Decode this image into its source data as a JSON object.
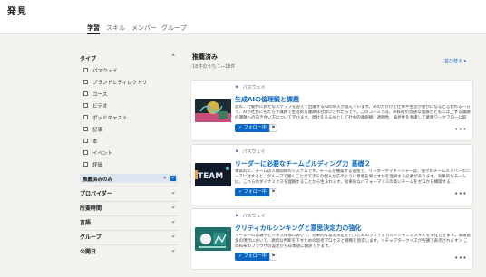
{
  "page": {
    "title": "発見"
  },
  "tabs": [
    {
      "label": "学習",
      "active": true
    },
    {
      "label": "スキル",
      "active": false
    },
    {
      "label": "メンバー",
      "active": false
    },
    {
      "label": "グループ",
      "active": false
    }
  ],
  "sidebar": {
    "type_section": {
      "label": "タイプ",
      "items": [
        {
          "label": "パスウェイ",
          "checked": false
        },
        {
          "label": "ブランドとディレクトリ",
          "checked": false
        },
        {
          "label": "コース",
          "checked": false
        },
        {
          "label": "ビデオ",
          "checked": false
        },
        {
          "label": "ポッドキャスト",
          "checked": false
        },
        {
          "label": "記事",
          "checked": false
        },
        {
          "label": "本",
          "checked": false
        },
        {
          "label": "イベント",
          "checked": false
        },
        {
          "label": "評価",
          "checked": false
        }
      ]
    },
    "recommended_filter": {
      "label": "推薦済みのみ",
      "remove": "✕",
      "checked": true
    },
    "sections": [
      {
        "label": "プロバイダー"
      },
      {
        "label": "所要時間"
      },
      {
        "label": "言語"
      },
      {
        "label": "グループ"
      },
      {
        "label": "公開日"
      }
    ]
  },
  "results": {
    "title": "推薦済み",
    "count": "18件のうち 1―18件",
    "sort_label": "並び替え ▾",
    "items": [
      {
        "type": "パスウェイ",
        "title": "生成AIの倫理観と課題",
        "description": "近年、行動界に新たなステップを迎えて出展するAIの導入が進んでいます。AIの力がけで仕事や生活が豊かになると言われる一方で、AIが社会にもたらす課題で生活的な課題は社会にされたらです。このコースでは、AI技術の急速な発展とともに浮上する課題の課題への向き合い方について学びます。愛社をあるAIとして社会的価値観、透明性、偏見性を考慮して業務ワークフローに取り...",
        "follow_label": "✓ フォロー中",
        "save_label": "⚑",
        "more_label": "•••"
      },
      {
        "type": "パスウェイ",
        "title": "リーダーに必要なチームビルディング力_基礎２",
        "description": "本質的に、チームは人間関係のシステムです。チームを構築する過程で、リーダーやマネージャーは、個々のチームメンバーのニーズに対すると、グループで働くことができるの個人が広のように意義を果たすかを理解する必要があります。効果的なチームは、これらのダイナミクスを理解することから生まれます。効果的なパフォーマンスの高いチームをゼロから構築する...",
        "follow_label": "✓ フォロー中",
        "save_label": "⚑",
        "more_label": "•••"
      },
      {
        "type": "パスウェイ",
        "title": "クリティカルシンキングと意思決定力の強化",
        "description": "リーダーの意識やビジネス環境において、効果的な意思決定を行うためのクリティカルシンキングスキルを深化させます。情報過多の現代において、適切な判断を下すための思考プロセスと戦略を習得します。＜チャプタークイズが各講で表示されます＞ この和布のブラウザの設定から日本語に翻訳できます。",
        "follow_label": "✓ フォロー中",
        "save_label": "⚑",
        "more_label": "•••"
      }
    ]
  }
}
